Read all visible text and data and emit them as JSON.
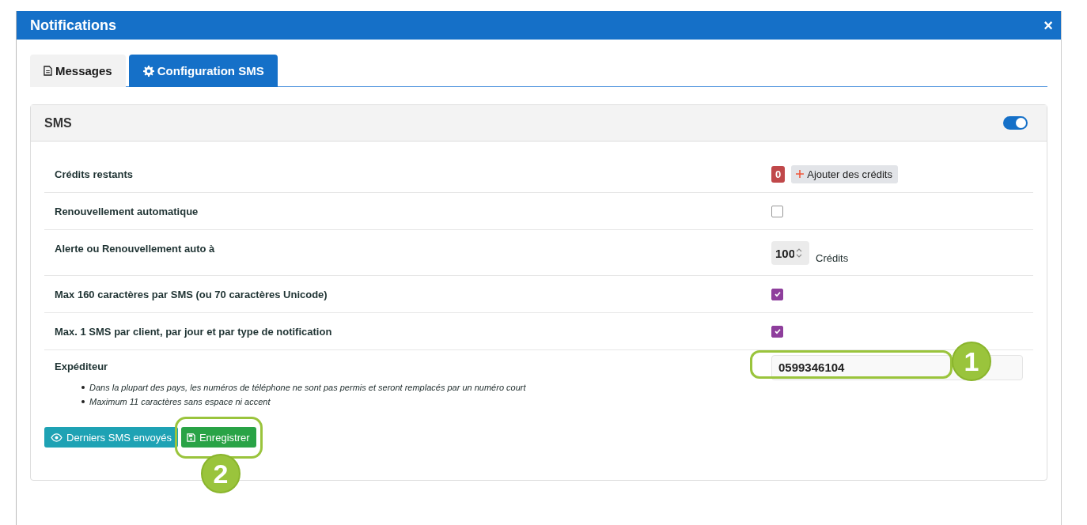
{
  "window": {
    "title": "Notifications",
    "close": "×"
  },
  "tabs": [
    {
      "kind": "document",
      "label": "Messages",
      "selected": false
    },
    {
      "kind": "gear",
      "label": "Configuration SMS",
      "selected": true
    }
  ],
  "panel": {
    "title": "SMS",
    "enabled": true,
    "rows": [
      {
        "kind": "credits",
        "label": "Crédits restants",
        "count": "0",
        "button": "Ajouter des crédits"
      },
      {
        "kind": "checkbox",
        "label": "Renouvellement automatique",
        "checked": false
      },
      {
        "kind": "number",
        "label": "Alerte ou Renouvellement auto à",
        "value": "100",
        "unit": "Crédits"
      },
      {
        "kind": "checkbox",
        "label": "Max 160 caractères par SMS (ou 70 caractères Unicode)",
        "checked": true
      },
      {
        "kind": "checkbox",
        "label": "Max. 1 SMS par client, par jour et par type de notification",
        "checked": true
      },
      {
        "kind": "text",
        "label": "Expéditeur",
        "value": "0599346104",
        "notes": [
          "Dans la plupart des pays, les numéros de téléphone ne sont pas permis et seront remplacés par un numéro court",
          "Maximum 11 caractères sans espace ni accent"
        ],
        "callout": "1"
      }
    ],
    "buttons": [
      {
        "kind": "view",
        "label": "Derniers SMS envoyés"
      },
      {
        "kind": "save",
        "label": "Enregistrer",
        "callout": "2"
      }
    ]
  }
}
